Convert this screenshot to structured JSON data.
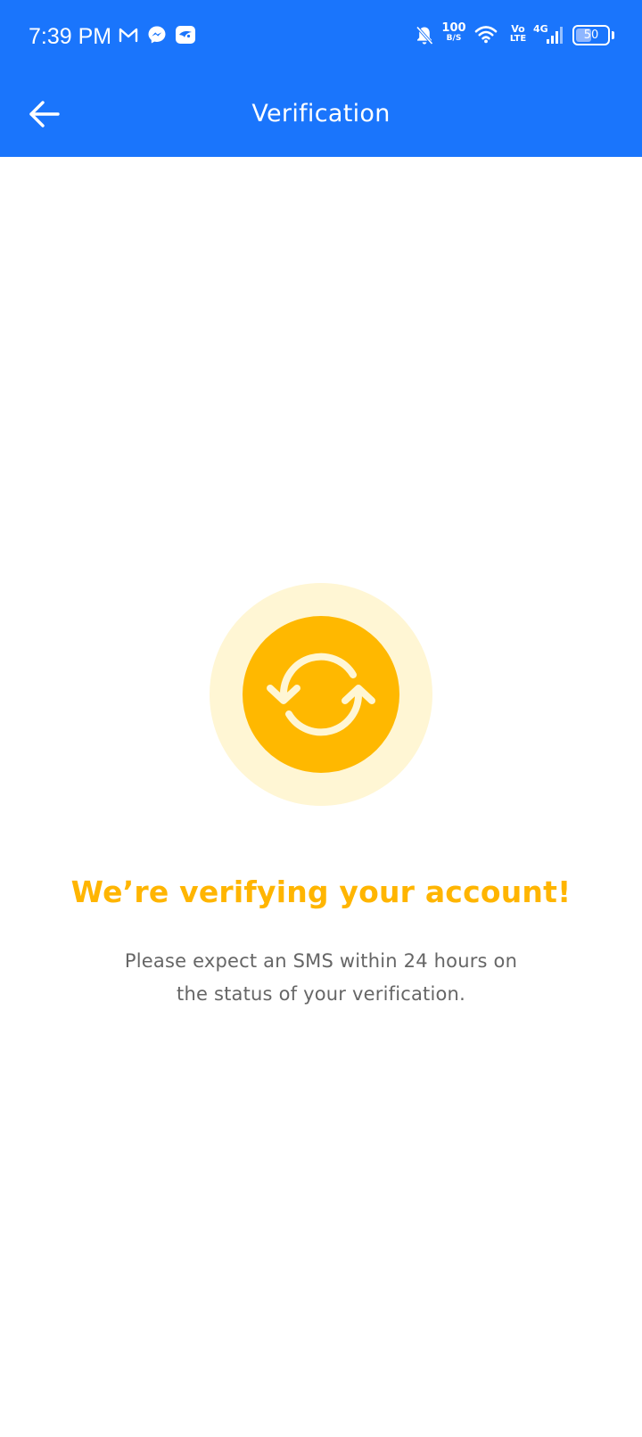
{
  "status_bar": {
    "time": "7:39 PM",
    "notification_icons": [
      "gmail-icon",
      "messenger-icon",
      "app-notification-icon"
    ],
    "network_speed_value": "100",
    "network_speed_unit": "B/S",
    "volte_top": "Vo",
    "volte_bottom": "LTE",
    "network_type": "4G",
    "battery_level": "50",
    "battery_fraction": 0.5
  },
  "app_bar": {
    "title": "Verification",
    "back_icon": "arrow-left-icon"
  },
  "content": {
    "illustration_icon": "refresh-icon",
    "headline": "We’re verifying your account!",
    "body_line_1": "Please expect an SMS within 24 hours on",
    "body_line_2": "the status of your verification."
  },
  "colors": {
    "primary_blue": "#1a75fc",
    "accent_yellow": "#ffb800",
    "accent_yellow_light": "#fff6d4",
    "headline_yellow": "#ffb500",
    "body_text_gray": "#666666"
  }
}
